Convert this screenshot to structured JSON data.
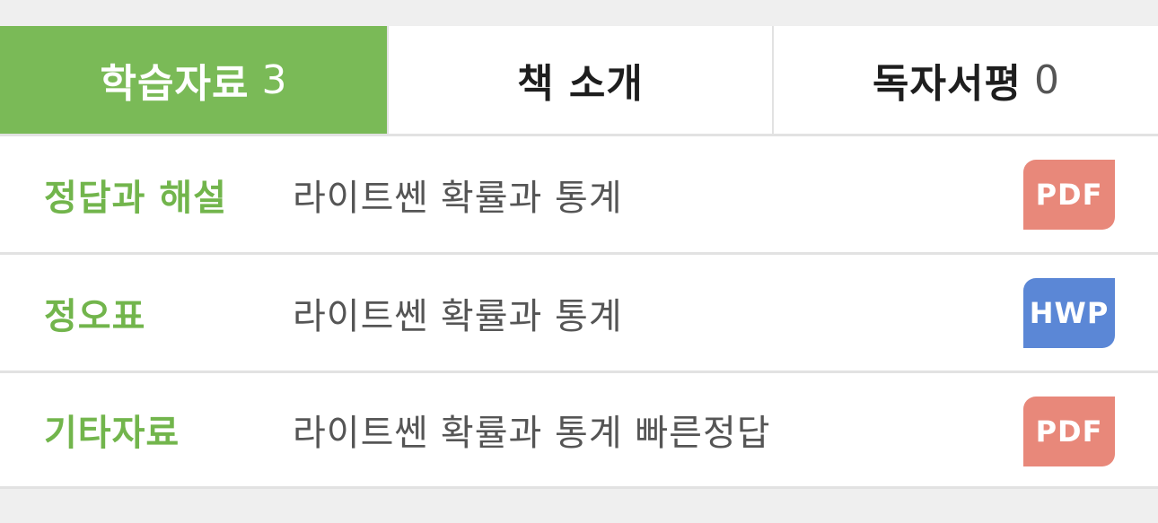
{
  "tabs": [
    {
      "label": "학습자료",
      "count": "3",
      "active": true
    },
    {
      "label": "책 소개",
      "count": "",
      "active": false
    },
    {
      "label": "독자서평",
      "count": "0",
      "active": false
    }
  ],
  "colors": {
    "accent": "#7aba57",
    "category_text": "#72b54c",
    "pdf_badge": "#e8887a",
    "hwp_badge": "#5b87d6"
  },
  "rows": [
    {
      "category": "정답과 해설",
      "title": "라이트쎈 확률과 통계",
      "badge": "PDF",
      "badge_color": "#e8887a"
    },
    {
      "category": "정오표",
      "title": "라이트쎈 확률과 통계",
      "badge": "HWP",
      "badge_color": "#5b87d6"
    },
    {
      "category": "기타자료",
      "title": "라이트쎈 확률과 통계 빠른정답",
      "badge": "PDF",
      "badge_color": "#e8887a"
    }
  ]
}
